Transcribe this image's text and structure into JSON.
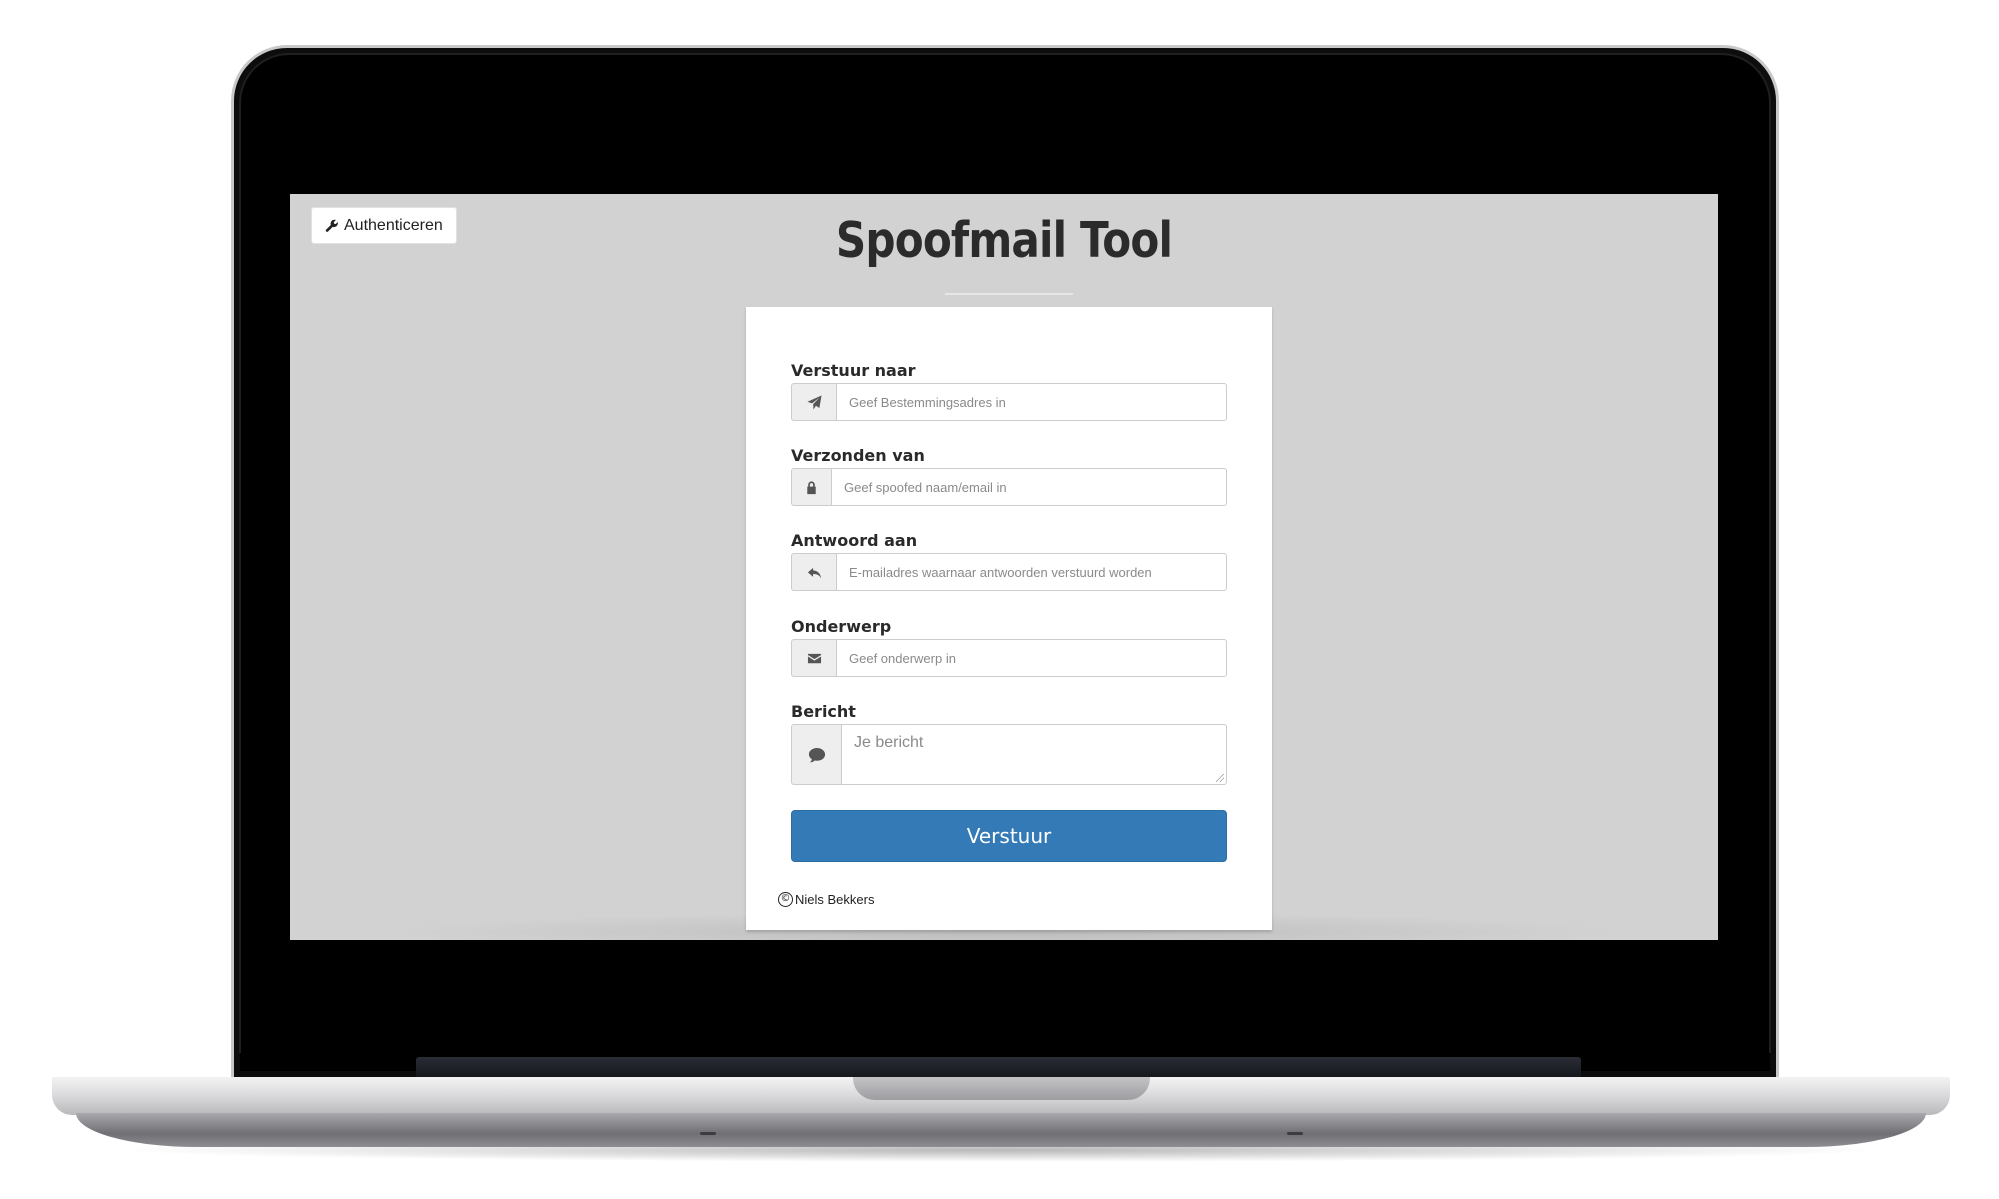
{
  "header": {
    "auth_button_label": "Authenticeren",
    "title": "Spoofmail Tool"
  },
  "form": {
    "to": {
      "label": "Verstuur naar",
      "placeholder": "Geef Bestemmingsadres in",
      "icon": "paper-plane-icon"
    },
    "from": {
      "label": "Verzonden van",
      "placeholder": "Geef spoofed naam/email in",
      "icon": "lock-icon"
    },
    "reply_to": {
      "label": "Antwoord aan",
      "placeholder": "E-mailadres waarnaar antwoorden verstuurd worden",
      "icon": "reply-icon"
    },
    "subject": {
      "label": "Onderwerp",
      "placeholder": "Geef onderwerp in",
      "icon": "envelope-icon"
    },
    "message": {
      "label": "Bericht",
      "placeholder": "Je bericht",
      "icon": "comment-icon"
    },
    "submit_label": "Verstuur"
  },
  "footer": {
    "copyright_symbol": "©",
    "author": "Niels Bekkers"
  },
  "colors": {
    "screen_background": "#d2d2d2",
    "primary_button": "#337ab7"
  }
}
